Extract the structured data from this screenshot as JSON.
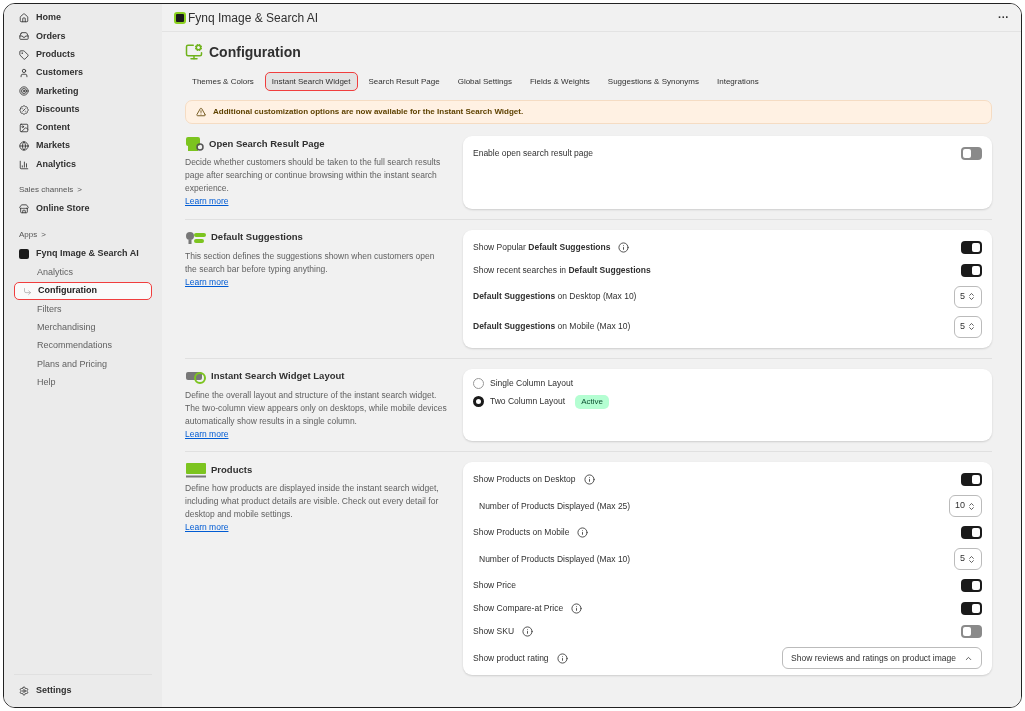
{
  "sidebar": {
    "nav": [
      {
        "label": "Home"
      },
      {
        "label": "Orders"
      },
      {
        "label": "Products"
      },
      {
        "label": "Customers"
      },
      {
        "label": "Marketing"
      },
      {
        "label": "Discounts"
      },
      {
        "label": "Content"
      },
      {
        "label": "Markets"
      },
      {
        "label": "Analytics"
      }
    ],
    "sales_channels": {
      "heading": "Sales channels",
      "chevron": ">",
      "items": [
        {
          "label": "Online Store"
        }
      ]
    },
    "apps": {
      "heading": "Apps",
      "chevron": ">",
      "app": "Fynq Image & Search AI",
      "items": [
        {
          "label": "Analytics",
          "selected": false
        },
        {
          "label": "Configuration",
          "selected": true
        },
        {
          "label": "Filters",
          "selected": false
        },
        {
          "label": "Merchandising",
          "selected": false
        },
        {
          "label": "Recommendations",
          "selected": false
        },
        {
          "label": "Plans and Pricing",
          "selected": false
        },
        {
          "label": "Help",
          "selected": false
        }
      ]
    },
    "settings": "Settings"
  },
  "header": {
    "title": "Fynq Image & Search AI",
    "menu": "···"
  },
  "page": {
    "title": "Configuration",
    "tabs": [
      {
        "label": "Themes & Colors",
        "selected": false
      },
      {
        "label": "Instant Search Widget",
        "selected": true
      },
      {
        "label": "Search Result Page",
        "selected": false
      },
      {
        "label": "Global Settings",
        "selected": false
      },
      {
        "label": "Fields & Weights",
        "selected": false
      },
      {
        "label": "Suggestions & Synonyms",
        "selected": false
      },
      {
        "label": "Integrations",
        "selected": false
      }
    ],
    "banner": "Additional customization options are now available for the Instant Search Widget.",
    "sections": [
      {
        "title": "Open Search Result Page",
        "description": "Decide whether customers should be taken to the full search results page after searching or continue browsing within the instant search experience.",
        "link": "Learn more",
        "items": [
          {
            "kind": "toggle",
            "label": "Enable open search result page",
            "on": false,
            "info": false,
            "indented": false
          }
        ]
      },
      {
        "title": "Default Suggestions",
        "description": "This section defines the suggestions shown when customers open the search bar before typing anything.",
        "link": "Learn more",
        "items": [
          {
            "kind": "toggle",
            "label": "Show Popular **Default Suggestions**",
            "on": true,
            "info": true,
            "indented": false
          },
          {
            "kind": "toggle",
            "label": "Show recent searches in **Default Suggestions**",
            "on": true,
            "info": false,
            "indented": false
          },
          {
            "kind": "number",
            "label": "**Default Suggestions** on Desktop (Max 10)",
            "value": "5",
            "info": false,
            "indented": false
          },
          {
            "kind": "number",
            "label": "**Default Suggestions** on Mobile (Max 10)",
            "value": "5",
            "info": false,
            "indented": false
          }
        ]
      },
      {
        "title": "Instant Search Widget Layout",
        "description": "Define the overall layout and structure of the instant search widget. The two-column view appears only on desktops, while mobile devices automatically show results in a single column.",
        "link": "Learn more",
        "items": [
          {
            "kind": "radio",
            "label": "Single Column Layout",
            "selected": false
          },
          {
            "kind": "radio",
            "label": "Two Column Layout",
            "selected": true,
            "badge": "Active"
          }
        ]
      },
      {
        "title": "Products",
        "description": "Define how products are displayed inside the instant search widget, including what product details are visible. Check out every detail for desktop and mobile settings.",
        "link": "Learn more",
        "items": [
          {
            "kind": "toggle",
            "label": "Show Products on Desktop",
            "on": true,
            "info": true,
            "indented": false
          },
          {
            "kind": "number",
            "label": "Number of Products Displayed (Max 25)",
            "value": "10",
            "info": false,
            "indented": true
          },
          {
            "kind": "toggle",
            "label": "Show Products on Mobile",
            "on": true,
            "info": true,
            "indented": false
          },
          {
            "kind": "number",
            "label": "Number of Products Displayed (Max 10)",
            "value": "5",
            "info": false,
            "indented": true
          },
          {
            "kind": "toggle",
            "label": "Show Price",
            "on": true,
            "info": false,
            "indented": false
          },
          {
            "kind": "toggle",
            "label": "Show Compare-at Price",
            "on": true,
            "info": true,
            "indented": false
          },
          {
            "kind": "toggle",
            "label": "Show SKU",
            "on": false,
            "info": true,
            "indented": false
          },
          {
            "kind": "select",
            "label": "Show product rating",
            "value": "Show reviews and ratings on product image",
            "info": true,
            "indented": false
          }
        ]
      }
    ]
  }
}
